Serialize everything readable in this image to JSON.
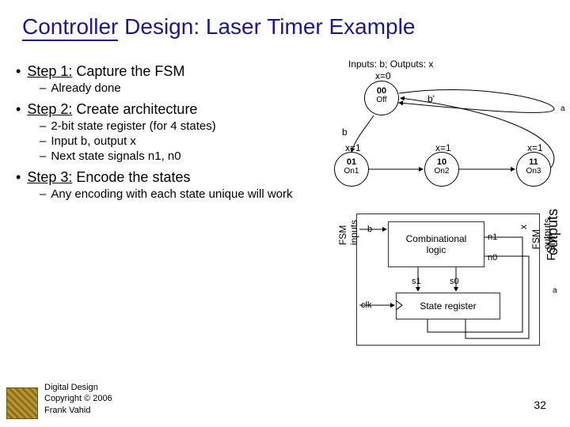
{
  "title_a": "Controller",
  "title_b": "Design: Laser Timer Example",
  "steps": {
    "s1": {
      "label": "Step 1:",
      "text": "Capture the FSM",
      "sub": [
        "Already done"
      ]
    },
    "s2": {
      "label": "Step 2:",
      "text": "Create architecture",
      "sub": [
        "2-bit state register (for 4 states)",
        "Input b, output x",
        "Next state signals n1, n0"
      ]
    },
    "s3": {
      "label": "Step 3:",
      "text": "Encode the states",
      "sub": [
        "Any encoding with each state unique will work"
      ]
    }
  },
  "fsm": {
    "io": "Inputs: b; Outputs: x",
    "x0": "x=0",
    "x1a": "x=1",
    "x1b": "x=1",
    "x1c": "x=1",
    "off": {
      "code": "00",
      "name": "Off"
    },
    "on1": {
      "code": "01",
      "name": "On1"
    },
    "on2": {
      "code": "10",
      "name": "On2"
    },
    "on3": {
      "code": "11",
      "name": "On3"
    },
    "bprime": "b'",
    "b": "b",
    "a": "a"
  },
  "arch": {
    "fsm_in": "FSM\ninputs",
    "fsm_out": "FSM\noutputs",
    "outputs_big": "outputs",
    "fsm_big": "FSM",
    "b": "b",
    "x": "x",
    "comb": "Combinational\nlogic",
    "n1": "n1",
    "n0": "n0",
    "s1": "s1",
    "s0": "s0",
    "clk": "clk",
    "statereg": "State register",
    "a": "a"
  },
  "footer": {
    "l1": "Digital Design",
    "l2": "Copyright © 2006",
    "l3": "Frank Vahid"
  },
  "page": "32"
}
